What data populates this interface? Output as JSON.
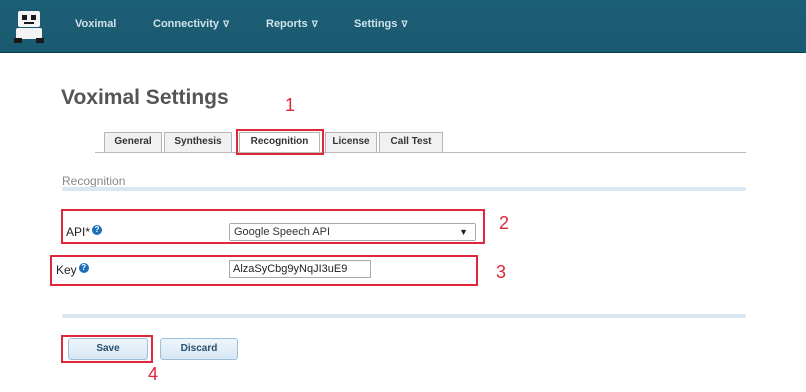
{
  "nav": {
    "logo_icon": "robot-logo-icon",
    "items": [
      {
        "label": "Voximal",
        "has_caret": false
      },
      {
        "label": "Connectivity",
        "has_caret": true
      },
      {
        "label": "Reports",
        "has_caret": true
      },
      {
        "label": "Settings",
        "has_caret": true
      }
    ],
    "caret_glyph": "∇"
  },
  "page": {
    "title": "Voximal Settings"
  },
  "tabs": [
    {
      "label": "General",
      "active": false
    },
    {
      "label": "Synthesis",
      "active": false
    },
    {
      "label": "Recognition",
      "active": true
    },
    {
      "label": "License",
      "active": false
    },
    {
      "label": "Call Test",
      "active": false
    }
  ],
  "section": {
    "title": "Recognition"
  },
  "form": {
    "api": {
      "label": "API*",
      "value": "Google Speech API",
      "help_icon": "question-circle-icon"
    },
    "key": {
      "label": "Key",
      "value": "AlzaSyCbg9yNqJI3uE9",
      "help_icon": "question-circle-icon"
    }
  },
  "buttons": {
    "save": "Save",
    "discard": "Discard"
  },
  "annotations": {
    "n1": "1",
    "n2": "2",
    "n3": "3",
    "n4": "4",
    "color": "#e0263a"
  },
  "colors": {
    "nav_bg": "#1a5a70",
    "accent": "#1d6fb8"
  }
}
